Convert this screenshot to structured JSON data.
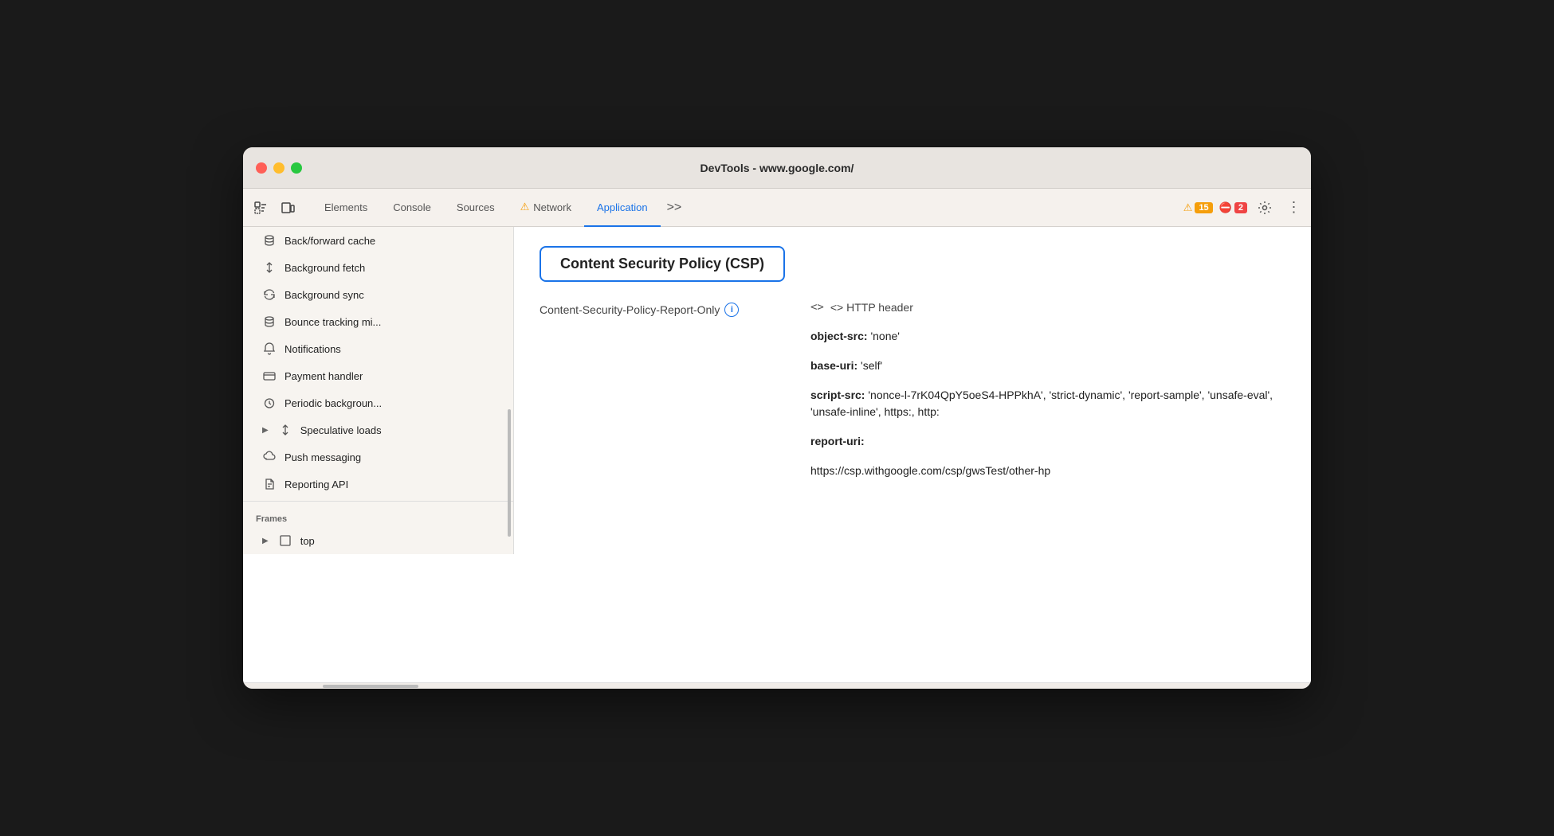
{
  "window": {
    "title": "DevTools - www.google.com/"
  },
  "tabs": [
    {
      "id": "elements",
      "label": "Elements",
      "active": false,
      "warning": false
    },
    {
      "id": "console",
      "label": "Console",
      "active": false,
      "warning": false
    },
    {
      "id": "sources",
      "label": "Sources",
      "active": false,
      "warning": false
    },
    {
      "id": "network",
      "label": "Network",
      "active": false,
      "warning": true
    },
    {
      "id": "application",
      "label": "Application",
      "active": true,
      "warning": false
    }
  ],
  "toolbar": {
    "more_label": ">>",
    "warning_count": "15",
    "error_count": "2"
  },
  "sidebar": {
    "items": [
      {
        "id": "back-forward-cache",
        "label": "Back/forward cache",
        "icon": "database",
        "indent": 1
      },
      {
        "id": "background-fetch",
        "label": "Background fetch",
        "icon": "arrow-up-down",
        "indent": 1
      },
      {
        "id": "background-sync",
        "label": "Background sync",
        "icon": "sync",
        "indent": 1
      },
      {
        "id": "bounce-tracking",
        "label": "Bounce tracking mi...",
        "icon": "database",
        "indent": 1
      },
      {
        "id": "notifications",
        "label": "Notifications",
        "icon": "bell",
        "indent": 1
      },
      {
        "id": "payment-handler",
        "label": "Payment handler",
        "icon": "card",
        "indent": 1
      },
      {
        "id": "periodic-background",
        "label": "Periodic backgroun...",
        "icon": "clock",
        "indent": 1
      },
      {
        "id": "speculative-loads",
        "label": "Speculative loads",
        "icon": "arrow-up-down",
        "indent": 1,
        "expandable": true
      },
      {
        "id": "push-messaging",
        "label": "Push messaging",
        "icon": "cloud",
        "indent": 1
      },
      {
        "id": "reporting-api",
        "label": "Reporting API",
        "icon": "file",
        "indent": 1
      }
    ],
    "frames_section": "Frames",
    "frames_item": "top"
  },
  "content": {
    "csp_title": "Content Security Policy (CSP)",
    "policy_name": "Content-Security-Policy-Report-Only",
    "http_header_label": "<> HTTP header",
    "entries": [
      {
        "key": "object-src:",
        "value": " 'none'"
      },
      {
        "key": "base-uri:",
        "value": " 'self'"
      },
      {
        "key": "script-src:",
        "value": " 'nonce-l-7rK04QpY5oeS4-HPPkhA', 'strict-dynamic', 'report-sample', 'unsafe-eval', 'unsafe-inline', https:, http:"
      },
      {
        "key": "report-uri:",
        "value": ""
      },
      {
        "key": "",
        "value": "https://csp.withgoogle.com/csp/gwsTest/other-hp"
      }
    ]
  }
}
